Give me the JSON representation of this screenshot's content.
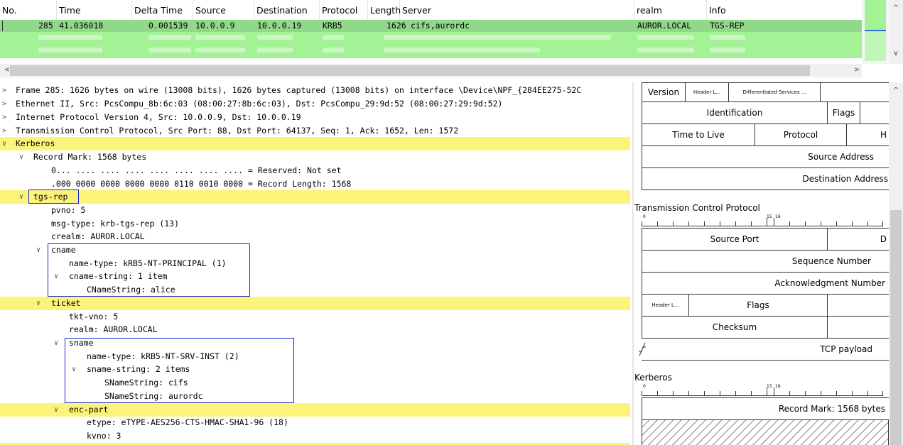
{
  "packet_list": {
    "columns": [
      "No.",
      "Time",
      "Delta Time",
      "Source",
      "Destination",
      "Protocol",
      "Length",
      "Server",
      "realm",
      "Info"
    ],
    "selected_row": {
      "no": "285",
      "time": "41.036018",
      "delta": "0.001539",
      "source": "10.0.0.9",
      "destination": "10.0.0.19",
      "protocol": "KRB5",
      "length": "1626",
      "server": "cifs,aurordc",
      "realm": "AUROR.LOCAL",
      "info": "TGS-REP"
    },
    "colors": {
      "selected": "#8fd989",
      "rows": "#a3f295"
    }
  },
  "details": {
    "frame": "Frame 285: 1626 bytes on wire (13008 bits), 1626 bytes captured (13008 bits) on interface \\Device\\NPF_{284EE275-52C",
    "ethernet": "Ethernet II, Src: PcsCompu_8b:6c:03 (08:00:27:8b:6c:03), Dst: PcsCompu_29:9d:52 (08:00:27:29:9d:52)",
    "ip": "Internet Protocol Version 4, Src: 10.0.0.9, Dst: 10.0.0.19",
    "tcp": "Transmission Control Protocol, Src Port: 88, Dst Port: 64137, Seq: 1, Ack: 1652, Len: 1572",
    "kerberos": "Kerberos",
    "record_mark": "Record Mark: 1568 bytes",
    "reserved": "0... .... .... .... .... .... .... .... = Reserved: Not set",
    "record_length": ".000 0000 0000 0000 0000 0110 0010 0000 = Record Length: 1568",
    "tgs_rep": "tgs-rep",
    "pvno": "pvno: 5",
    "msg_type": "msg-type: krb-tgs-rep (13)",
    "crealm": "crealm: AUROR.LOCAL",
    "cname": "cname",
    "cname_name_type": "name-type: kRB5-NT-PRINCIPAL (1)",
    "cname_string": "cname-string: 1 item",
    "cname_value": "CNameString: alice",
    "ticket": "ticket",
    "tkt_vno": "tkt-vno: 5",
    "realm": "realm: AUROR.LOCAL",
    "sname": "sname",
    "sname_name_type": "name-type: kRB5-NT-SRV-INST (2)",
    "sname_string": "sname-string: 2 items",
    "sname_value1": "SNameString: cifs",
    "sname_value2": "SNameString: aurordc",
    "enc_part": "enc-part",
    "etype": "etype: eTYPE-AES256-CTS-HMAC-SHA1-96 (18)",
    "kvno": "kvno: 3",
    "colors": {
      "highlight": "#fcf37a",
      "annotation_box": "#1427c7"
    }
  },
  "diagram": {
    "ip": {
      "version": "Version",
      "header_length": "Header L...",
      "dsfield": "Differentiated Services ...",
      "identification": "Identification",
      "flags": "Flags",
      "ttl": "Time to Live",
      "protocol": "Protocol",
      "checksum_cut": "H",
      "source": "Source Address",
      "destination": "Destination Address"
    },
    "tcp": {
      "title": "Transmission Control Protocol",
      "ruler_0": "0",
      "ruler_15": "15",
      "ruler_16": "16",
      "source_port": "Source Port",
      "dest_port_cut": "D",
      "seq": "Sequence Number",
      "ack": "Acknowledgment Number",
      "header_length": "Header L...",
      "flags": "Flags",
      "checksum": "Checksum",
      "payload": "TCP payload"
    },
    "kerberos": {
      "title": "Kerberos",
      "ruler_0": "0",
      "ruler_15": "15",
      "ruler_16": "16",
      "record_mark": "Record Mark: 1568 bytes"
    }
  }
}
